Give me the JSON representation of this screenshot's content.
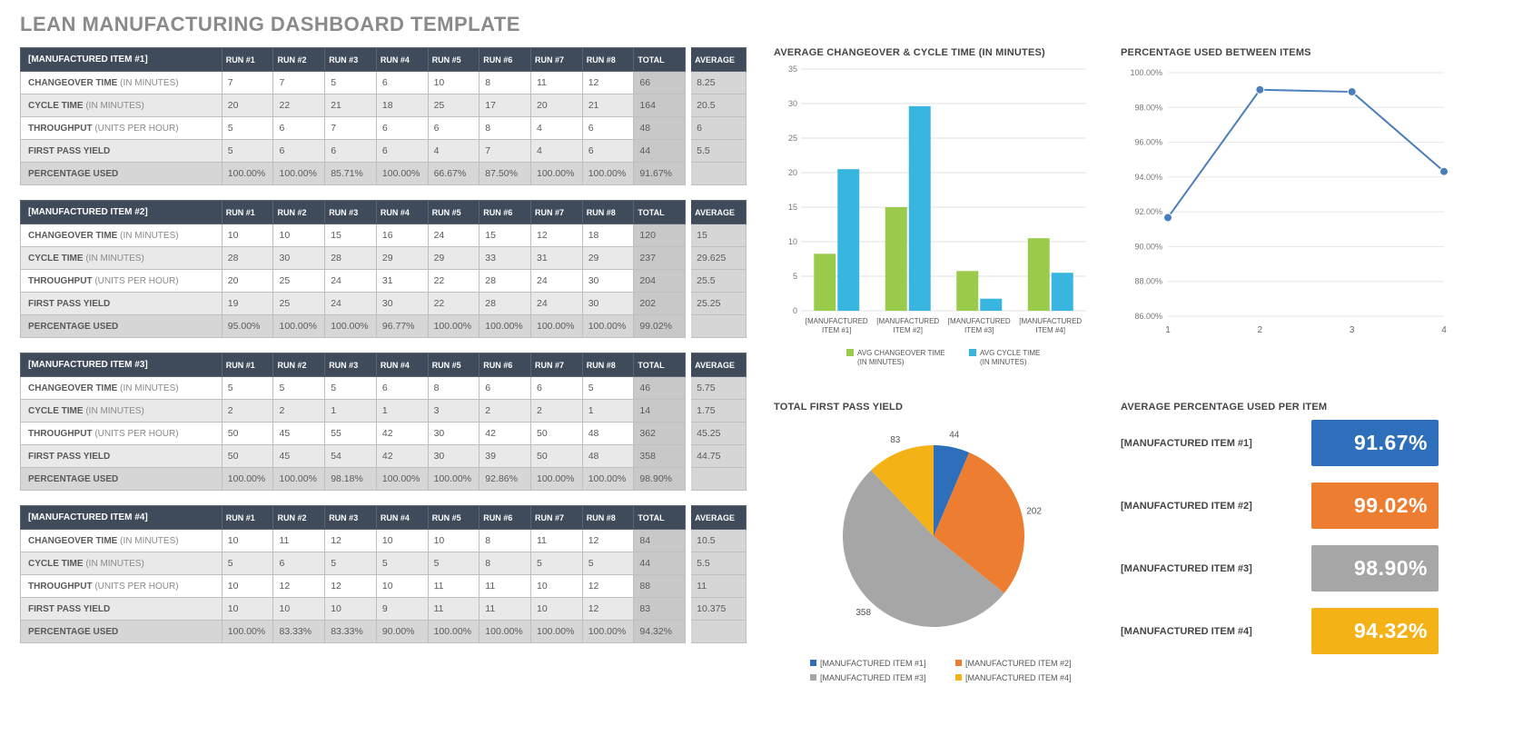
{
  "title": "LEAN MANUFACTURING DASHBOARD TEMPLATE",
  "run_headers": [
    "RUN #1",
    "RUN #2",
    "RUN #3",
    "RUN #4",
    "RUN #5",
    "RUN #6",
    "RUN #7",
    "RUN #8"
  ],
  "col_total": "TOTAL",
  "col_average": "AVERAGE",
  "metric_labels": {
    "changeover": "CHANGEOVER TIME",
    "changeover_sub": "(IN MINUTES)",
    "cycle": "CYCLE TIME",
    "cycle_sub": "(IN MINUTES)",
    "throughput": "THROUGHPUT",
    "throughput_sub": "(UNITS PER HOUR)",
    "fpy": "FIRST PASS YIELD",
    "pct": "PERCENTAGE USED"
  },
  "items": [
    {
      "name": "[MANUFACTURED ITEM #1]",
      "changeover": [
        "7",
        "7",
        "5",
        "6",
        "10",
        "8",
        "11",
        "12",
        "66",
        "8.25"
      ],
      "cycle": [
        "20",
        "22",
        "21",
        "18",
        "25",
        "17",
        "20",
        "21",
        "164",
        "20.5"
      ],
      "throughput": [
        "5",
        "6",
        "7",
        "6",
        "6",
        "8",
        "4",
        "6",
        "48",
        "6"
      ],
      "fpy": [
        "5",
        "6",
        "6",
        "6",
        "4",
        "7",
        "4",
        "6",
        "44",
        "5.5"
      ],
      "pct": [
        "100.00%",
        "100.00%",
        "85.71%",
        "100.00%",
        "66.67%",
        "87.50%",
        "100.00%",
        "100.00%",
        "91.67%",
        ""
      ]
    },
    {
      "name": "[MANUFACTURED ITEM #2]",
      "changeover": [
        "10",
        "10",
        "15",
        "16",
        "24",
        "15",
        "12",
        "18",
        "120",
        "15"
      ],
      "cycle": [
        "28",
        "30",
        "28",
        "29",
        "29",
        "33",
        "31",
        "29",
        "237",
        "29.625"
      ],
      "throughput": [
        "20",
        "25",
        "24",
        "31",
        "22",
        "28",
        "24",
        "30",
        "204",
        "25.5"
      ],
      "fpy": [
        "19",
        "25",
        "24",
        "30",
        "22",
        "28",
        "24",
        "30",
        "202",
        "25.25"
      ],
      "pct": [
        "95.00%",
        "100.00%",
        "100.00%",
        "96.77%",
        "100.00%",
        "100.00%",
        "100.00%",
        "100.00%",
        "99.02%",
        ""
      ]
    },
    {
      "name": "[MANUFACTURED ITEM #3]",
      "changeover": [
        "5",
        "5",
        "5",
        "6",
        "8",
        "6",
        "6",
        "5",
        "46",
        "5.75"
      ],
      "cycle": [
        "2",
        "2",
        "1",
        "1",
        "3",
        "2",
        "2",
        "1",
        "14",
        "1.75"
      ],
      "throughput": [
        "50",
        "45",
        "55",
        "42",
        "30",
        "42",
        "50",
        "48",
        "362",
        "45.25"
      ],
      "fpy": [
        "50",
        "45",
        "54",
        "42",
        "30",
        "39",
        "50",
        "48",
        "358",
        "44.75"
      ],
      "pct": [
        "100.00%",
        "100.00%",
        "98.18%",
        "100.00%",
        "100.00%",
        "92.86%",
        "100.00%",
        "100.00%",
        "98.90%",
        ""
      ]
    },
    {
      "name": "[MANUFACTURED ITEM #4]",
      "changeover": [
        "10",
        "11",
        "12",
        "10",
        "10",
        "8",
        "11",
        "12",
        "84",
        "10.5"
      ],
      "cycle": [
        "5",
        "6",
        "5",
        "5",
        "5",
        "8",
        "5",
        "5",
        "44",
        "5.5"
      ],
      "throughput": [
        "10",
        "12",
        "12",
        "10",
        "11",
        "11",
        "10",
        "12",
        "88",
        "11"
      ],
      "fpy": [
        "10",
        "10",
        "10",
        "9",
        "11",
        "11",
        "10",
        "12",
        "83",
        "10.375"
      ],
      "pct": [
        "100.00%",
        "83.33%",
        "83.33%",
        "90.00%",
        "100.00%",
        "100.00%",
        "100.00%",
        "100.00%",
        "94.32%",
        ""
      ]
    }
  ],
  "bar_chart": {
    "title": "AVERAGE CHANGEOVER & CYCLE TIME (IN MINUTES)",
    "legend": [
      "AVG CHANGEOVER TIME (IN MINUTES)",
      "AVG CYCLE TIME (IN MINUTES)"
    ]
  },
  "line_chart": {
    "title": "PERCENTAGE USED BETWEEN ITEMS"
  },
  "pie_chart": {
    "title": "TOTAL FIRST PASS YIELD",
    "legend": [
      "[MANUFACTURED ITEM #1]",
      "[MANUFACTURED ITEM #2]",
      "[MANUFACTURED ITEM #3]",
      "[MANUFACTURED ITEM #4]"
    ]
  },
  "kpi": {
    "title": "AVERAGE PERCENTAGE USED PER ITEM",
    "rows": [
      {
        "label": "[MANUFACTURED ITEM #1]",
        "value": "91.67%",
        "color": "c-blue"
      },
      {
        "label": "[MANUFACTURED ITEM #2]",
        "value": "99.02%",
        "color": "c-orange"
      },
      {
        "label": "[MANUFACTURED ITEM #3]",
        "value": "98.90%",
        "color": "c-grey"
      },
      {
        "label": "[MANUFACTURED ITEM #4]",
        "value": "94.32%",
        "color": "c-gold"
      }
    ]
  },
  "chart_data": [
    {
      "type": "bar",
      "title": "AVERAGE CHANGEOVER & CYCLE TIME (IN MINUTES)",
      "categories": [
        "[MANUFACTURED ITEM #1]",
        "[MANUFACTURED ITEM #2]",
        "[MANUFACTURED ITEM #3]",
        "[MANUFACTURED ITEM #4]"
      ],
      "series": [
        {
          "name": "AVG CHANGEOVER TIME (IN MINUTES)",
          "values": [
            8.25,
            15,
            5.75,
            10.5
          ]
        },
        {
          "name": "AVG CYCLE TIME (IN MINUTES)",
          "values": [
            20.5,
            29.625,
            1.75,
            5.5
          ]
        }
      ],
      "ylim": [
        0,
        35
      ],
      "yticks": [
        0,
        5,
        10,
        15,
        20,
        25,
        30,
        35
      ]
    },
    {
      "type": "line",
      "title": "PERCENTAGE USED BETWEEN ITEMS",
      "x": [
        1,
        2,
        3,
        4
      ],
      "values": [
        91.67,
        99.02,
        98.9,
        94.32
      ],
      "ylim": [
        86,
        100
      ],
      "yticks": [
        86,
        88,
        90,
        92,
        94,
        96,
        98,
        100
      ],
      "ytick_labels": [
        "86.00%",
        "88.00%",
        "90.00%",
        "92.00%",
        "94.00%",
        "96.00%",
        "98.00%",
        "100.00%"
      ]
    },
    {
      "type": "pie",
      "title": "TOTAL FIRST PASS YIELD",
      "categories": [
        "[MANUFACTURED ITEM #1]",
        "[MANUFACTURED ITEM #2]",
        "[MANUFACTURED ITEM #3]",
        "[MANUFACTURED ITEM #4]"
      ],
      "values": [
        44,
        202,
        358,
        83
      ]
    }
  ]
}
